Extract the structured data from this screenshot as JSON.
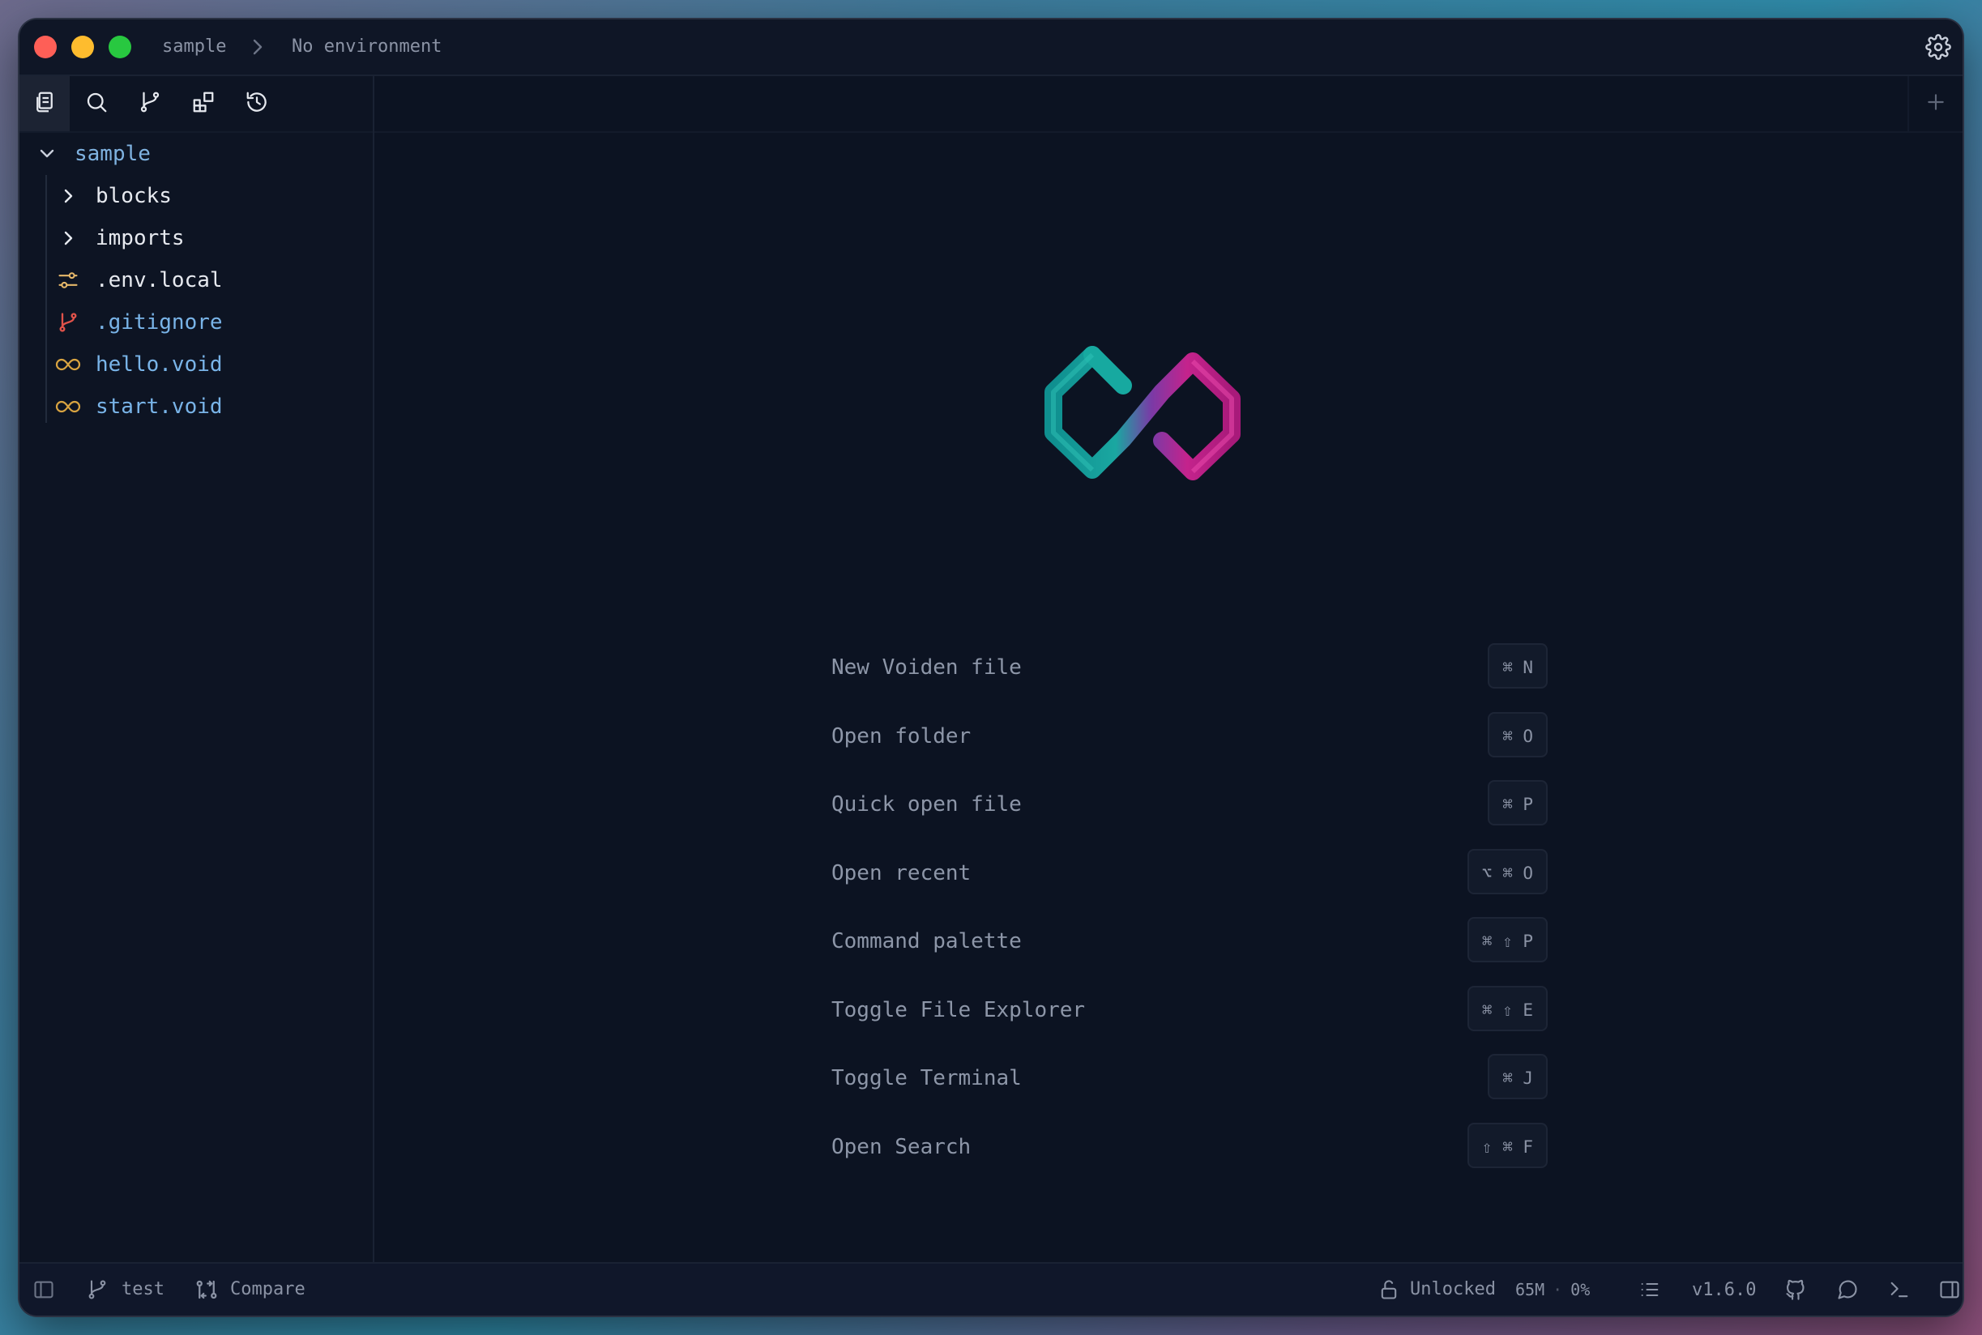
{
  "window": {
    "breadcrumb_project": "sample",
    "breadcrumb_environment": "No environment"
  },
  "sidebar": {
    "toolbar": [
      {
        "name": "files-icon"
      },
      {
        "name": "search-icon"
      },
      {
        "name": "git-branch-icon"
      },
      {
        "name": "extensions-icon"
      },
      {
        "name": "history-icon"
      }
    ],
    "tree": {
      "root": "sample",
      "folders": [
        "blocks",
        "imports"
      ],
      "files": [
        ".env.local",
        ".gitignore",
        "hello.void",
        "start.void"
      ]
    }
  },
  "welcome": {
    "commands": [
      {
        "label": "New Voiden file",
        "shortcut": "⌘ N"
      },
      {
        "label": "Open folder",
        "shortcut": "⌘ O"
      },
      {
        "label": "Quick open file",
        "shortcut": "⌘ P"
      },
      {
        "label": "Open recent",
        "shortcut": "⌥ ⌘ O"
      },
      {
        "label": "Command palette",
        "shortcut": "⌘ ⇧ P"
      },
      {
        "label": "Toggle File Explorer",
        "shortcut": "⌘ ⇧ E"
      },
      {
        "label": "Toggle Terminal",
        "shortcut": "⌘ J"
      },
      {
        "label": "Open Search",
        "shortcut": "⇧ ⌘ F"
      }
    ]
  },
  "statusbar": {
    "branch": "test",
    "compare": "Compare",
    "lock_state": "Unlocked",
    "memory": "65M",
    "separator": "·",
    "cpu": "0%",
    "version": "v1.6.0"
  },
  "colors": {
    "folder_text": "#e6e9ef",
    "root_text": "#7fb2e0",
    "env_icon": "#e6b86a",
    "git_icon": "#e0524a",
    "void_icon": "#d9a441",
    "gitignore_text": "#79b4e8",
    "void_text": "#79b4e8",
    "logo_teal": "#17a9a0",
    "logo_magenta": "#d0268f"
  }
}
